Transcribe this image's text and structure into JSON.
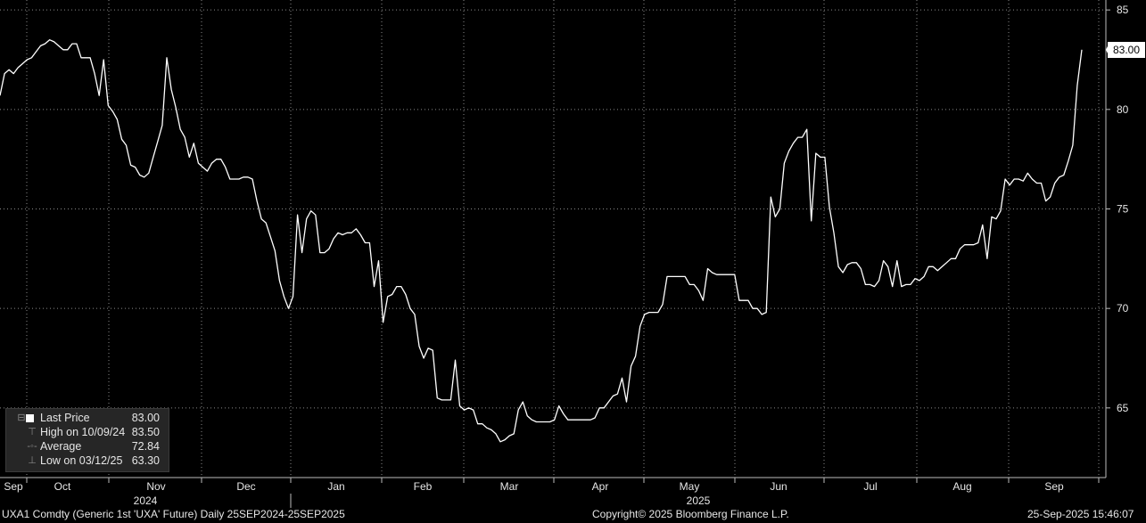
{
  "chart_data": {
    "type": "line",
    "ylim": [
      61.5,
      85.5
    ],
    "y_ticks": [
      "85",
      "80",
      "75",
      "70",
      "65"
    ],
    "x_month_labels": [
      "Sep",
      "Oct",
      "Nov",
      "Dec",
      "Jan",
      "Feb",
      "Mar",
      "Apr",
      "May",
      "Jun",
      "Jul",
      "Aug",
      "Sep"
    ],
    "x_year_labels": [
      "2024",
      "2025"
    ],
    "grid": true,
    "series": [
      {
        "name": "Last Price",
        "color": "#ffffff",
        "values": [
          80.7,
          81.8,
          82.0,
          81.8,
          82.1,
          82.3,
          82.5,
          82.6,
          82.9,
          83.2,
          83.3,
          83.5,
          83.4,
          83.2,
          83.0,
          83.0,
          83.3,
          83.3,
          82.6,
          82.6,
          82.6,
          81.8,
          80.7,
          82.5,
          80.2,
          79.9,
          79.5,
          78.5,
          78.2,
          77.2,
          77.1,
          76.7,
          76.6,
          76.8,
          77.6,
          78.4,
          79.2,
          82.6,
          81.0,
          80.1,
          79.0,
          78.6,
          77.6,
          78.3,
          77.3,
          77.1,
          76.9,
          77.3,
          77.5,
          77.5,
          77.1,
          76.5,
          76.5,
          76.5,
          76.6,
          76.6,
          76.5,
          75.4,
          74.5,
          74.3,
          73.6,
          72.9,
          71.4,
          70.6,
          70.0,
          70.6,
          74.7,
          72.8,
          74.5,
          74.9,
          74.7,
          72.8,
          72.8,
          73.0,
          73.5,
          73.8,
          73.7,
          73.8,
          73.8,
          74.0,
          73.7,
          73.3,
          73.3,
          71.1,
          72.4,
          69.3,
          70.6,
          70.7,
          71.1,
          71.1,
          70.7,
          70.0,
          69.7,
          68.1,
          67.5,
          68.0,
          67.9,
          65.5,
          65.4,
          65.4,
          65.4,
          67.4,
          65.1,
          64.9,
          65.0,
          64.9,
          64.2,
          64.2,
          64.0,
          63.9,
          63.7,
          63.3,
          63.4,
          63.6,
          63.7,
          64.9,
          65.3,
          64.6,
          64.4,
          64.3,
          64.3,
          64.3,
          64.3,
          64.4,
          65.1,
          64.7,
          64.4,
          64.4,
          64.4,
          64.4,
          64.4,
          64.4,
          64.5,
          65.0,
          65.0,
          65.3,
          65.6,
          65.7,
          66.5,
          65.3,
          67.1,
          67.6,
          69.1,
          69.7,
          69.8,
          69.8,
          69.8,
          70.2,
          71.6,
          71.6,
          71.6,
          71.6,
          71.6,
          71.2,
          71.2,
          70.9,
          70.4,
          72.0,
          71.8,
          71.7,
          71.7,
          71.7,
          71.7,
          71.7,
          70.4,
          70.4,
          70.4,
          70.0,
          70.0,
          69.7,
          69.8,
          75.6,
          74.6,
          75.0,
          77.3,
          77.9,
          78.3,
          78.6,
          78.6,
          79.0,
          74.4,
          77.8,
          77.6,
          77.6,
          75.1,
          73.8,
          72.1,
          71.8,
          72.2,
          72.3,
          72.3,
          72.0,
          71.2,
          71.2,
          71.1,
          71.4,
          72.4,
          72.1,
          71.1,
          72.4,
          71.1,
          71.2,
          71.2,
          71.5,
          71.4,
          71.6,
          72.1,
          72.1,
          71.9,
          72.1,
          72.3,
          72.5,
          72.5,
          73.0,
          73.2,
          73.2,
          73.2,
          73.3,
          74.2,
          72.5,
          74.6,
          74.5,
          74.9,
          76.5,
          76.2,
          76.5,
          76.5,
          76.4,
          76.8,
          76.5,
          76.3,
          76.3,
          75.4,
          75.6,
          76.3,
          76.6,
          76.7,
          77.4,
          78.2,
          81.2,
          83.0
        ]
      }
    ],
    "legend": {
      "placement": "bottom-left",
      "entries": [
        {
          "label": "Last Price",
          "value": "83.00",
          "icon": "square-swatch"
        },
        {
          "label": "High on 10/09/24",
          "value": "83.50",
          "icon": "high-marker"
        },
        {
          "label": "Average",
          "value": "72.84",
          "icon": "average-marker"
        },
        {
          "label": "Low on 03/12/25",
          "value": "63.30",
          "icon": "low-marker"
        }
      ]
    },
    "last_value_tag": "83.00"
  },
  "footer": {
    "left": "UXA1 Comdty (Generic 1st 'UXA' Future)  Daily 25SEP2024-25SEP2025",
    "center": "Copyright© 2025 Bloomberg Finance L.P.",
    "right": "25-Sep-2025 15:46:07"
  }
}
